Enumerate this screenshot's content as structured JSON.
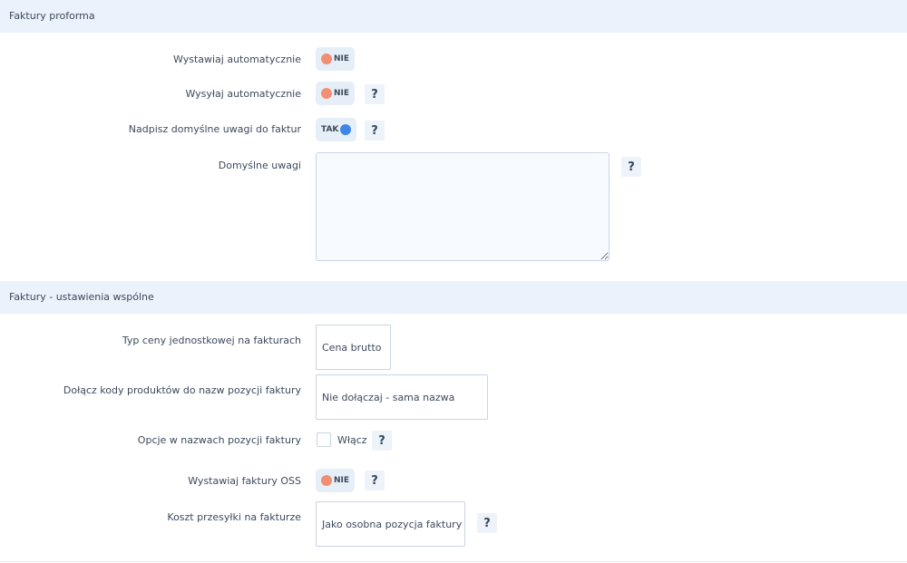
{
  "proforma": {
    "section_title": "Faktury proforma",
    "auto_issue": {
      "label": "Wystawiaj automatycznie",
      "toggle": "NIE"
    },
    "auto_send": {
      "label": "Wysyłaj automatycznie",
      "toggle": "NIE",
      "help": "?"
    },
    "override_notes": {
      "label": "Nadpisz domyślne uwagi do faktur",
      "toggle": "TAK",
      "help": "?"
    },
    "default_notes": {
      "label": "Domyślne uwagi",
      "value": "",
      "help": "?"
    }
  },
  "common": {
    "section_title": "Faktury - ustawienia wspólne",
    "unit_price_type": {
      "label": "Typ ceny jednostkowej na fakturach",
      "value": "Cena brutto"
    },
    "product_codes": {
      "label": "Dołącz kody produktów do nazw pozycji faktury",
      "value": "Nie dołączaj - sama nazwa"
    },
    "options_in_names": {
      "label": "Opcje w nazwach pozycji faktury",
      "checkbox_label": "Włącz",
      "checked": false,
      "help": "?"
    },
    "oss_invoices": {
      "label": "Wystawiaj faktury OSS",
      "toggle": "NIE",
      "help": "?"
    },
    "shipping_cost": {
      "label": "Koszt przesyłki na fakturze",
      "value": "Jako osobna pozycja faktury",
      "help": "?"
    }
  },
  "colors": {
    "header_bg": "#eaf2fb",
    "toggle_off": "#f28e73",
    "toggle_on": "#3d86e8"
  }
}
